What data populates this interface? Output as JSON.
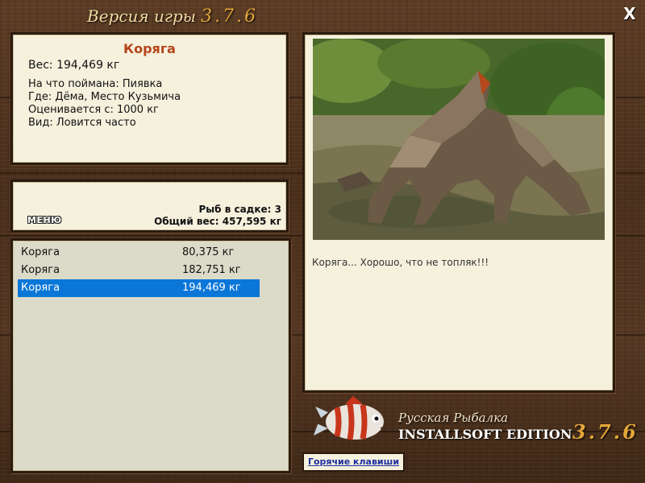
{
  "window": {
    "title_prefix": "Версия игры",
    "title_version": "3.7.6",
    "close_label": "X"
  },
  "fish_info": {
    "name": "Коряга",
    "weight": "Вес: 194,469 кг",
    "details": [
      "На что поймана: Пиявка",
      "Где: Дёма, Место Кузьмича",
      "Оценивается с: 1000 кг",
      "Вид: Ловится часто"
    ]
  },
  "stats": {
    "menu_label": "МЕНЮ",
    "fish_count": "Рыб в садке: 3",
    "total_weight": "Общий вес: 457,595 кг"
  },
  "catch_list": [
    {
      "name": "Коряга",
      "weight": "80,375 кг",
      "selected": false
    },
    {
      "name": "Коряга",
      "weight": "182,751 кг",
      "selected": false
    },
    {
      "name": "Коряга",
      "weight": "194,469 кг",
      "selected": true
    }
  ],
  "photo": {
    "caption": "Коряга... Хорошо, что не топляк!!!"
  },
  "brand": {
    "line1": "Русская Рыбалка",
    "line2": "INSTALLSOFT EDITION",
    "version": "3.7.6"
  },
  "hotkeys_label": "Горячие клавиши",
  "colors": {
    "accent_orange": "#b5451b",
    "selection_blue": "#0a76d8",
    "version_gold": "#e3a63a",
    "link_blue": "#1f2fa0"
  }
}
